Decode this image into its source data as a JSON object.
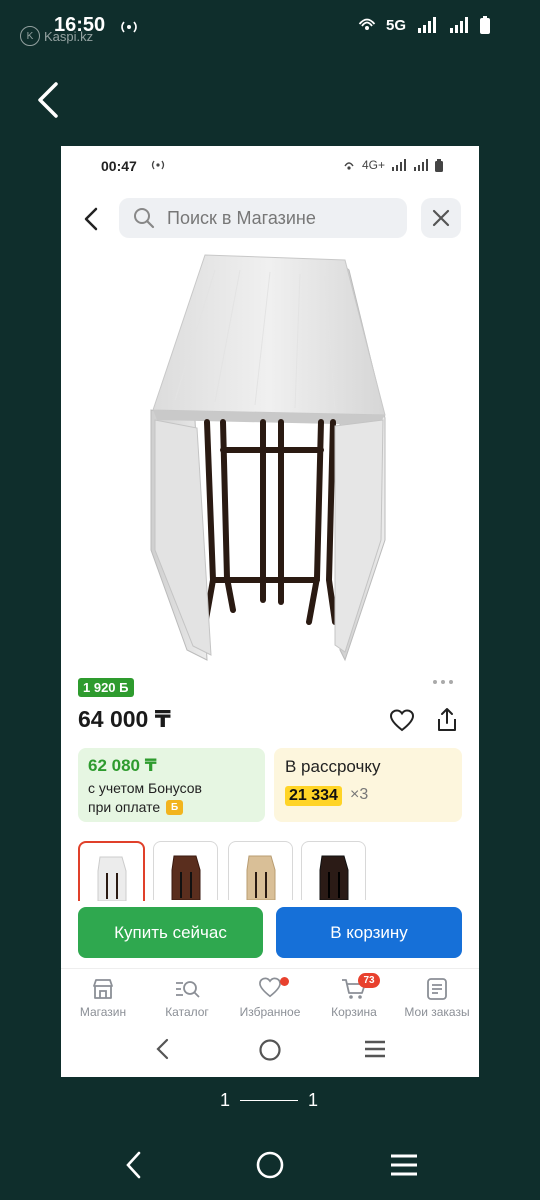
{
  "outer_status": {
    "time": "16:50",
    "watermark": "Kaspi.kz",
    "network": "5G"
  },
  "frame_status": {
    "time": "00:47",
    "network": "4G+"
  },
  "search": {
    "placeholder": "Поиск в Магазине"
  },
  "product": {
    "bonus_badge": "1 920 Б",
    "price": "64 000 ₸",
    "bonus_price": "62 080 ₸",
    "bonus_line1": "с учетом Бонусов",
    "bonus_line2": "при оплате",
    "bonus_coin": "Б",
    "installment_title": "В рассрочку",
    "installment_amount": "21 334",
    "installment_multiplier": "×3",
    "color_variants": [
      "white",
      "dark-brown",
      "light-oak",
      "black"
    ]
  },
  "actions": {
    "buy_now": "Купить сейчас",
    "to_cart": "В корзину"
  },
  "tabbar": {
    "items": [
      {
        "label": "Магазин",
        "icon": "store-icon"
      },
      {
        "label": "Каталог",
        "icon": "catalog-search-icon"
      },
      {
        "label": "Избранное",
        "icon": "heart-icon"
      },
      {
        "label": "Корзина",
        "icon": "cart-icon",
        "badge": "73"
      },
      {
        "label": "Мои заказы",
        "icon": "orders-icon"
      }
    ]
  },
  "pager": {
    "current": "1",
    "total": "1"
  },
  "colors": {
    "green": "#2fa84f",
    "blue": "#1670d8",
    "badge_red": "#e8412e",
    "installment_yellow": "#ffd426",
    "background": "#0f2e2c"
  }
}
